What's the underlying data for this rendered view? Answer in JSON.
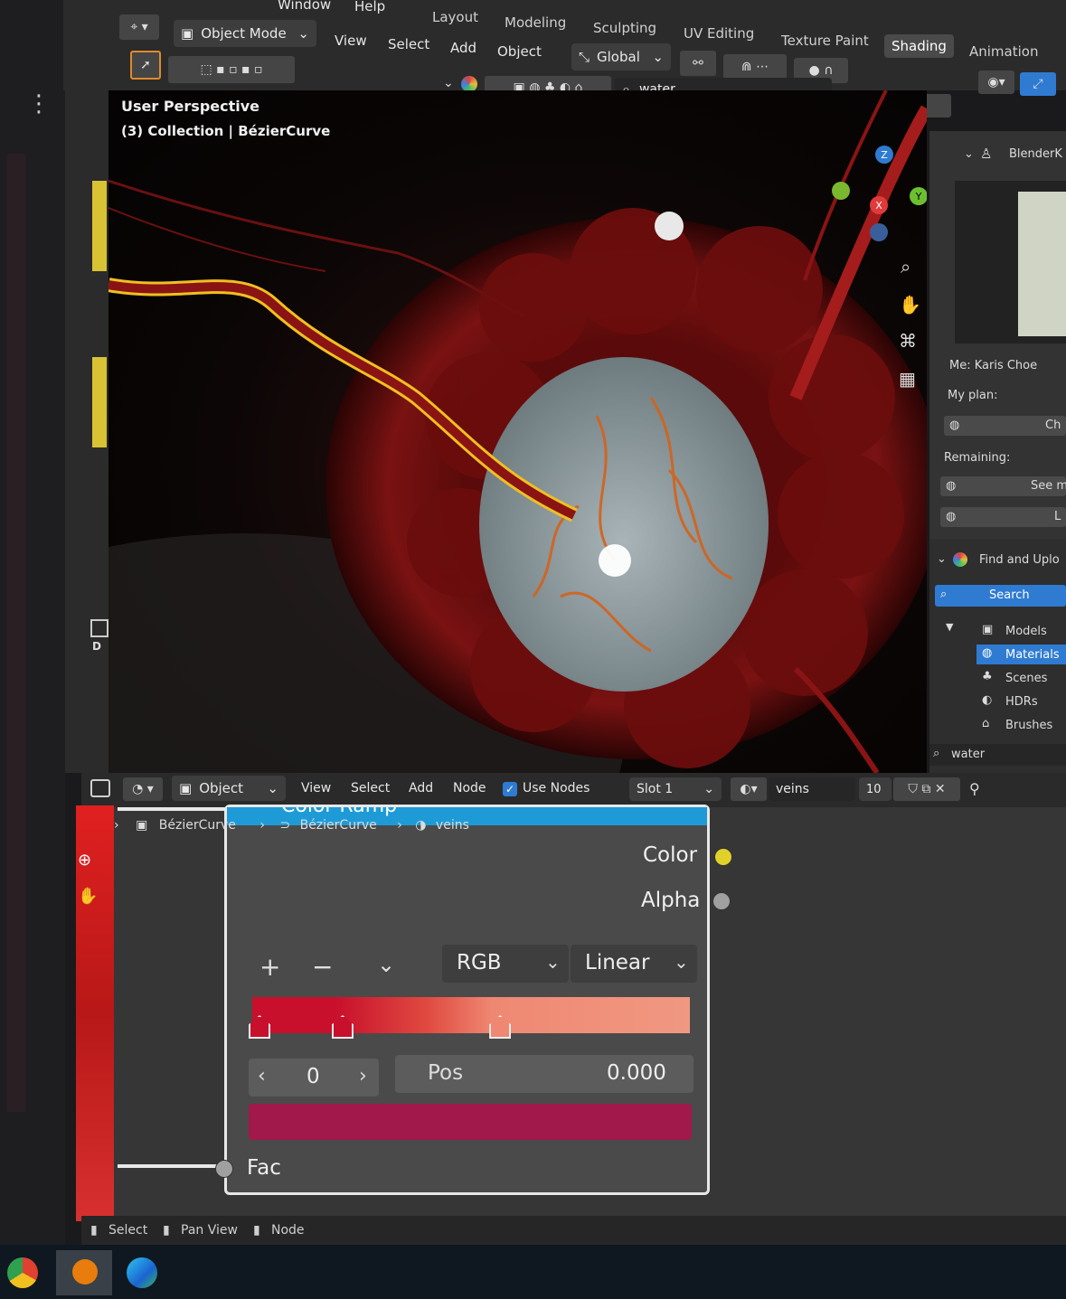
{
  "top_menu": {
    "window": "Window",
    "help": "Help"
  },
  "workspaces": [
    "Layout",
    "Modeling",
    "Sculpting",
    "UV Editing",
    "Texture Paint",
    "Shading",
    "Animation"
  ],
  "viewport_header": {
    "mode": "Object Mode",
    "menus": [
      "View",
      "Select",
      "Add",
      "Object"
    ],
    "orientation": "Global",
    "search_value": "water"
  },
  "viewport_overlay": {
    "perspective": "User Perspective",
    "collection": "(3) Collection | BézierCurve"
  },
  "gizmo": {
    "z": "Z",
    "y": "Y",
    "x": "X"
  },
  "sidebar": {
    "addon_title": "BlenderK",
    "me_label": "Me: Karis Choe",
    "plan_label": "My plan:",
    "plan_btn": "Ch",
    "remaining_label": "Remaining:",
    "remaining_btn": "See m",
    "third_btn": "L",
    "find_title": "Find and Uplo",
    "search_btn": "Search",
    "categories": [
      "Models",
      "Materials",
      "Scenes",
      "HDRs",
      "Brushes"
    ],
    "active_category": "Materials",
    "search_value": "water"
  },
  "node_header": {
    "mode": "Object",
    "menus": [
      "View",
      "Select",
      "Add",
      "Node"
    ],
    "use_nodes": "Use Nodes",
    "slot": "Slot 1",
    "material": "veins",
    "users": "10"
  },
  "breadcrumb": [
    "BézierCurve",
    "BézierCurve",
    "veins"
  ],
  "node": {
    "title": "Color Ramp",
    "out_color": "Color",
    "out_alpha": "Alpha",
    "add": "+",
    "remove": "−",
    "color_mode": "RGB",
    "interpolation": "Linear",
    "index": "0",
    "pos_label": "Pos",
    "pos_value": "0.000",
    "input_fac": "Fac",
    "ramp_stops": [
      0.0,
      0.19,
      0.55
    ],
    "selected_color": "#a0194a"
  },
  "status_bar": [
    "Select",
    "Pan View",
    "Node"
  ],
  "colors": {
    "accent_blue": "#2f7bd1",
    "socket_yellow": "#e0d12a",
    "socket_gray": "#a0a0a0",
    "node_header_blue": "#1e9bd7",
    "selection_outline": "#f0c020"
  }
}
